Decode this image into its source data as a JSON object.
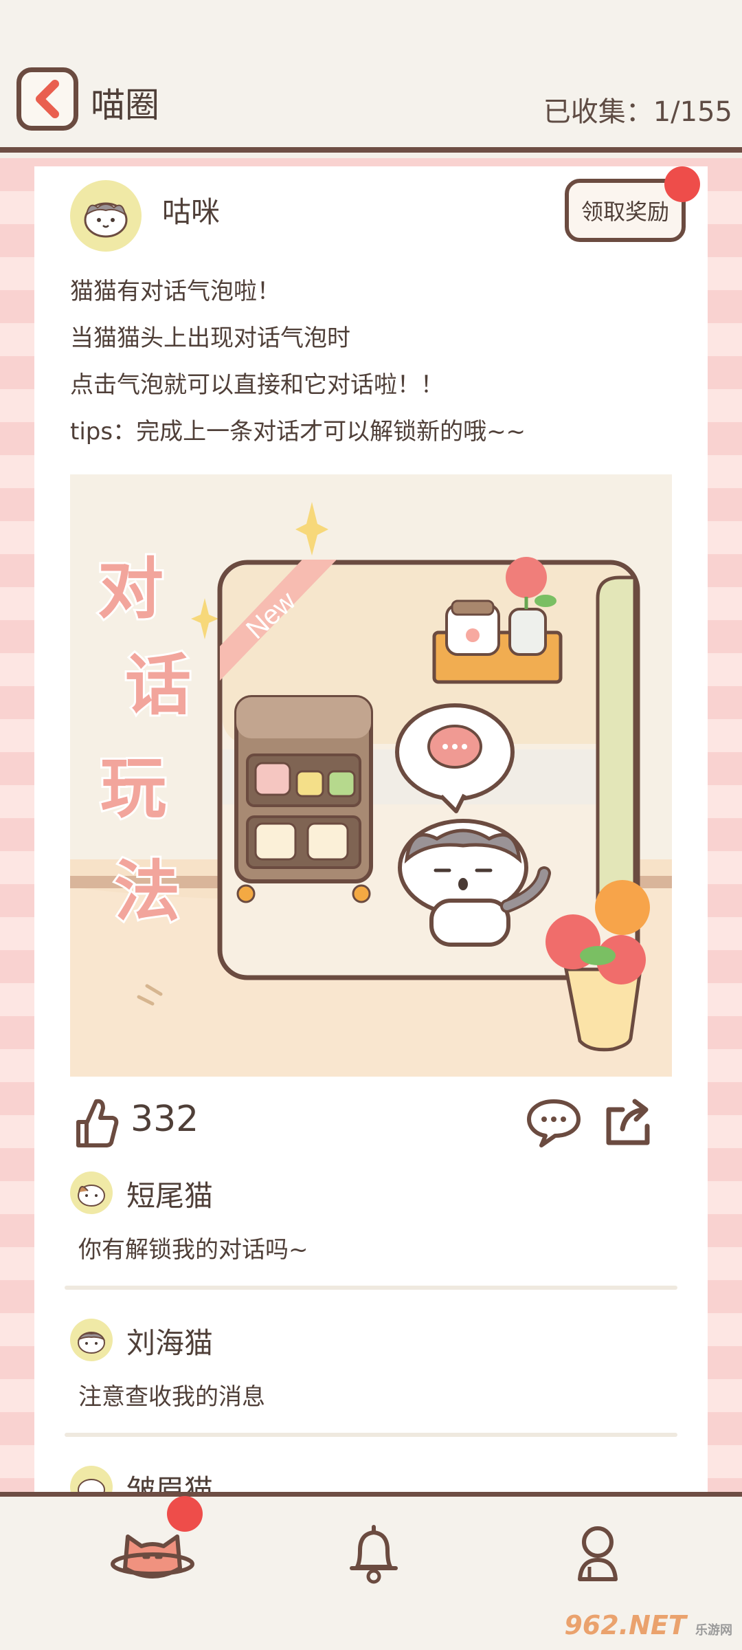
{
  "header": {
    "title": "喵圈",
    "collected": "已收集：1/155"
  },
  "post": {
    "author": "咕咪",
    "reward_label": "领取奖励",
    "lines": [
      "猫猫有对话气泡啦！",
      "当猫猫头上出现对话气泡时",
      "点击气泡就可以直接和它对话啦！！",
      "tips：完成上一条对话才可以解锁新的哦~~"
    ],
    "illustration": {
      "badge": "New",
      "caption_chars": [
        "对",
        "话",
        "玩",
        "法"
      ]
    },
    "likes": "332"
  },
  "comments": [
    {
      "name": "短尾猫",
      "text": "你有解锁我的对话吗~"
    },
    {
      "name": "刘海猫",
      "text": "注意查收我的消息"
    },
    {
      "name": "皱眉猫",
      "text": ""
    }
  ],
  "watermark": {
    "brand": "962.NET",
    "sub": "乐游网"
  },
  "colors": {
    "accent_brown": "#6b4b40",
    "notification_red": "#ee4d4a",
    "stripe_pink": "#f9d2d0",
    "caption_pink": "#f2a59c"
  },
  "icons": {
    "back": "chevron-left-icon",
    "like": "thumbs-up-icon",
    "comment": "speech-bubble-icon",
    "share": "share-icon",
    "nav_home": "cat-planet-icon",
    "nav_notifications": "bell-icon",
    "nav_profile": "person-icon"
  }
}
